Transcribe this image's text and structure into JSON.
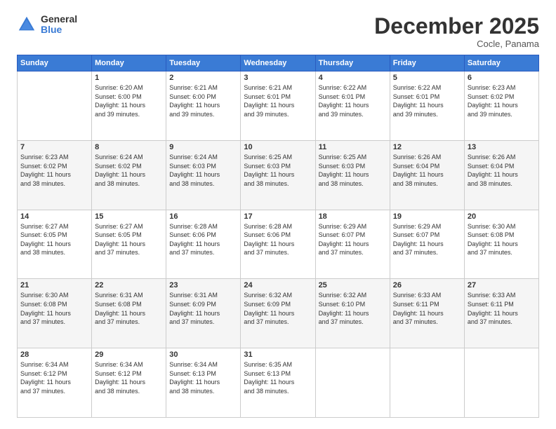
{
  "logo": {
    "general": "General",
    "blue": "Blue"
  },
  "title": "December 2025",
  "subtitle": "Cocle, Panama",
  "days_header": [
    "Sunday",
    "Monday",
    "Tuesday",
    "Wednesday",
    "Thursday",
    "Friday",
    "Saturday"
  ],
  "weeks": [
    [
      {
        "num": "",
        "info": ""
      },
      {
        "num": "1",
        "info": "Sunrise: 6:20 AM\nSunset: 6:00 PM\nDaylight: 11 hours\nand 39 minutes."
      },
      {
        "num": "2",
        "info": "Sunrise: 6:21 AM\nSunset: 6:00 PM\nDaylight: 11 hours\nand 39 minutes."
      },
      {
        "num": "3",
        "info": "Sunrise: 6:21 AM\nSunset: 6:01 PM\nDaylight: 11 hours\nand 39 minutes."
      },
      {
        "num": "4",
        "info": "Sunrise: 6:22 AM\nSunset: 6:01 PM\nDaylight: 11 hours\nand 39 minutes."
      },
      {
        "num": "5",
        "info": "Sunrise: 6:22 AM\nSunset: 6:01 PM\nDaylight: 11 hours\nand 39 minutes."
      },
      {
        "num": "6",
        "info": "Sunrise: 6:23 AM\nSunset: 6:02 PM\nDaylight: 11 hours\nand 39 minutes."
      }
    ],
    [
      {
        "num": "7",
        "info": "Sunrise: 6:23 AM\nSunset: 6:02 PM\nDaylight: 11 hours\nand 38 minutes."
      },
      {
        "num": "8",
        "info": "Sunrise: 6:24 AM\nSunset: 6:02 PM\nDaylight: 11 hours\nand 38 minutes."
      },
      {
        "num": "9",
        "info": "Sunrise: 6:24 AM\nSunset: 6:03 PM\nDaylight: 11 hours\nand 38 minutes."
      },
      {
        "num": "10",
        "info": "Sunrise: 6:25 AM\nSunset: 6:03 PM\nDaylight: 11 hours\nand 38 minutes."
      },
      {
        "num": "11",
        "info": "Sunrise: 6:25 AM\nSunset: 6:03 PM\nDaylight: 11 hours\nand 38 minutes."
      },
      {
        "num": "12",
        "info": "Sunrise: 6:26 AM\nSunset: 6:04 PM\nDaylight: 11 hours\nand 38 minutes."
      },
      {
        "num": "13",
        "info": "Sunrise: 6:26 AM\nSunset: 6:04 PM\nDaylight: 11 hours\nand 38 minutes."
      }
    ],
    [
      {
        "num": "14",
        "info": "Sunrise: 6:27 AM\nSunset: 6:05 PM\nDaylight: 11 hours\nand 38 minutes."
      },
      {
        "num": "15",
        "info": "Sunrise: 6:27 AM\nSunset: 6:05 PM\nDaylight: 11 hours\nand 37 minutes."
      },
      {
        "num": "16",
        "info": "Sunrise: 6:28 AM\nSunset: 6:06 PM\nDaylight: 11 hours\nand 37 minutes."
      },
      {
        "num": "17",
        "info": "Sunrise: 6:28 AM\nSunset: 6:06 PM\nDaylight: 11 hours\nand 37 minutes."
      },
      {
        "num": "18",
        "info": "Sunrise: 6:29 AM\nSunset: 6:07 PM\nDaylight: 11 hours\nand 37 minutes."
      },
      {
        "num": "19",
        "info": "Sunrise: 6:29 AM\nSunset: 6:07 PM\nDaylight: 11 hours\nand 37 minutes."
      },
      {
        "num": "20",
        "info": "Sunrise: 6:30 AM\nSunset: 6:08 PM\nDaylight: 11 hours\nand 37 minutes."
      }
    ],
    [
      {
        "num": "21",
        "info": "Sunrise: 6:30 AM\nSunset: 6:08 PM\nDaylight: 11 hours\nand 37 minutes."
      },
      {
        "num": "22",
        "info": "Sunrise: 6:31 AM\nSunset: 6:08 PM\nDaylight: 11 hours\nand 37 minutes."
      },
      {
        "num": "23",
        "info": "Sunrise: 6:31 AM\nSunset: 6:09 PM\nDaylight: 11 hours\nand 37 minutes."
      },
      {
        "num": "24",
        "info": "Sunrise: 6:32 AM\nSunset: 6:09 PM\nDaylight: 11 hours\nand 37 minutes."
      },
      {
        "num": "25",
        "info": "Sunrise: 6:32 AM\nSunset: 6:10 PM\nDaylight: 11 hours\nand 37 minutes."
      },
      {
        "num": "26",
        "info": "Sunrise: 6:33 AM\nSunset: 6:11 PM\nDaylight: 11 hours\nand 37 minutes."
      },
      {
        "num": "27",
        "info": "Sunrise: 6:33 AM\nSunset: 6:11 PM\nDaylight: 11 hours\nand 37 minutes."
      }
    ],
    [
      {
        "num": "28",
        "info": "Sunrise: 6:34 AM\nSunset: 6:12 PM\nDaylight: 11 hours\nand 37 minutes."
      },
      {
        "num": "29",
        "info": "Sunrise: 6:34 AM\nSunset: 6:12 PM\nDaylight: 11 hours\nand 38 minutes."
      },
      {
        "num": "30",
        "info": "Sunrise: 6:34 AM\nSunset: 6:13 PM\nDaylight: 11 hours\nand 38 minutes."
      },
      {
        "num": "31",
        "info": "Sunrise: 6:35 AM\nSunset: 6:13 PM\nDaylight: 11 hours\nand 38 minutes."
      },
      {
        "num": "",
        "info": ""
      },
      {
        "num": "",
        "info": ""
      },
      {
        "num": "",
        "info": ""
      }
    ]
  ]
}
